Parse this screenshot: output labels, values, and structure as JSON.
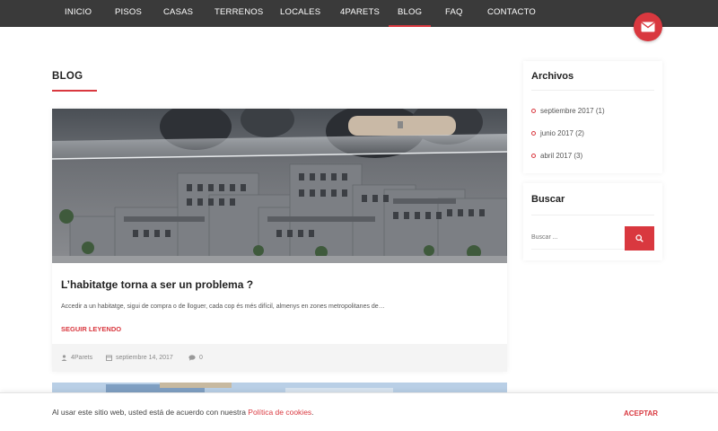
{
  "nav": {
    "items": [
      {
        "label": "INICIO"
      },
      {
        "label": "PISOS"
      },
      {
        "label": "CASAS"
      },
      {
        "label": "TERRENOS"
      },
      {
        "label": "LOCALES"
      },
      {
        "label": "4PARETS"
      },
      {
        "label": "BLOG",
        "active": true
      },
      {
        "label": "FAQ"
      },
      {
        "label": "CONTACTO"
      }
    ],
    "mail_icon": "envelope-icon"
  },
  "page": {
    "heading": "BLOG"
  },
  "post": {
    "title": "L’habitatge torna a ser un problema ?",
    "excerpt": "Accedir a un habitatge, sigui de compra o de lloguer, cada cop és més difícil, almenys en zones metropolitanes de…",
    "read_more": "SEGUIR LEYENDO",
    "author": "4Parets",
    "date": "septiembre 14, 2017",
    "comments": "0"
  },
  "sidebar": {
    "archives_title": "Archivos",
    "archives": [
      {
        "label": "septiembre 2017",
        "count": "(1)"
      },
      {
        "label": "junio 2017",
        "count": "(2)"
      },
      {
        "label": "abril 2017",
        "count": "(3)"
      }
    ],
    "search_title": "Buscar",
    "search_placeholder": "Buscar ..."
  },
  "cookie": {
    "text": "Al usar este sitio web, usted está de acuerdo con nuestra ",
    "link": "Política de cookies",
    "suffix": ".",
    "accept": "ACEPTAR"
  },
  "colors": {
    "accent": "#d9383f",
    "nav_bg": "#3a3a3a"
  }
}
